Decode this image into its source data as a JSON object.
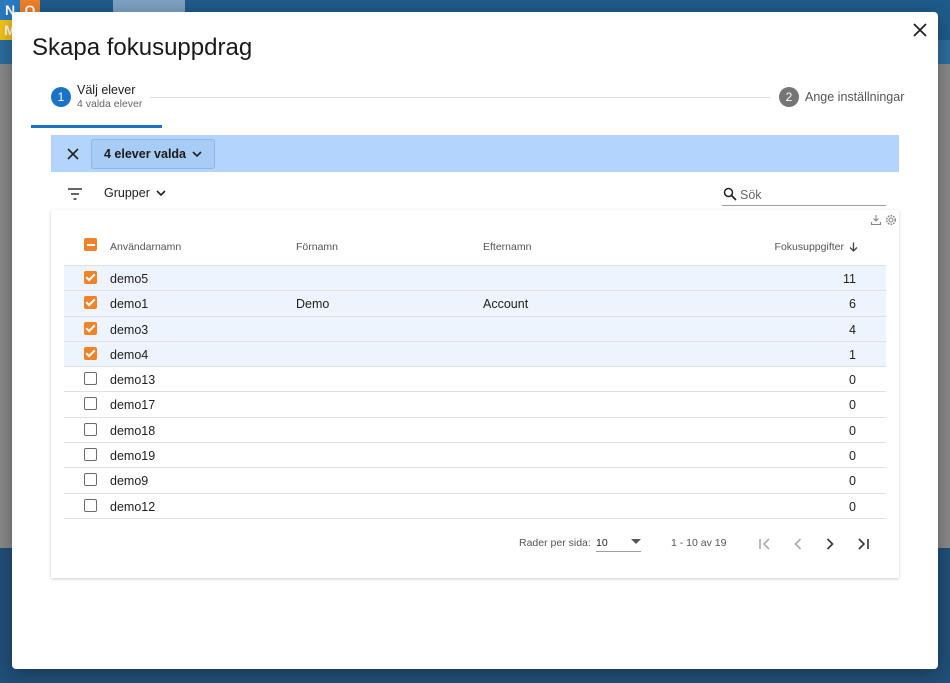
{
  "background": {
    "logo_letters": [
      "N",
      "O",
      "M"
    ]
  },
  "dialog": {
    "title": "Skapa fokusuppdrag",
    "stepper": {
      "step1": {
        "number": "1",
        "label": "Välj elever",
        "sublabel": "4 valda elever"
      },
      "step2": {
        "number": "2",
        "label": "Ange inställningar"
      }
    },
    "selection_bar": {
      "selected_label": "4 elever valda"
    },
    "filter": {
      "groups_label": "Grupper",
      "search_placeholder": "Sök"
    },
    "table": {
      "columns": {
        "username": "Användarnamn",
        "firstname": "Förnamn",
        "lastname": "Efternamn",
        "tasks": "Fokusuppgifter"
      },
      "rows": [
        {
          "username": "demo5",
          "firstname": "",
          "lastname": "",
          "tasks": "11",
          "checked": true
        },
        {
          "username": "demo1",
          "firstname": "Demo",
          "lastname": "Account",
          "tasks": "6",
          "checked": true
        },
        {
          "username": "demo3",
          "firstname": "",
          "lastname": "",
          "tasks": "4",
          "checked": true
        },
        {
          "username": "demo4",
          "firstname": "",
          "lastname": "",
          "tasks": "1",
          "checked": true
        },
        {
          "username": "demo13",
          "firstname": "",
          "lastname": "",
          "tasks": "0",
          "checked": false
        },
        {
          "username": "demo17",
          "firstname": "",
          "lastname": "",
          "tasks": "0",
          "checked": false
        },
        {
          "username": "demo18",
          "firstname": "",
          "lastname": "",
          "tasks": "0",
          "checked": false
        },
        {
          "username": "demo19",
          "firstname": "",
          "lastname": "",
          "tasks": "0",
          "checked": false
        },
        {
          "username": "demo9",
          "firstname": "",
          "lastname": "",
          "tasks": "0",
          "checked": false
        },
        {
          "username": "demo12",
          "firstname": "",
          "lastname": "",
          "tasks": "0",
          "checked": false
        }
      ]
    },
    "pagination": {
      "rows_per_page_label": "Rader per sida:",
      "rows_per_page_value": "10",
      "range_label": "1 - 10 av 19"
    }
  },
  "colors": {
    "primary": "#1a73c7",
    "checkbox": "#f0822a",
    "selection_bar": "#b3d4fc"
  }
}
